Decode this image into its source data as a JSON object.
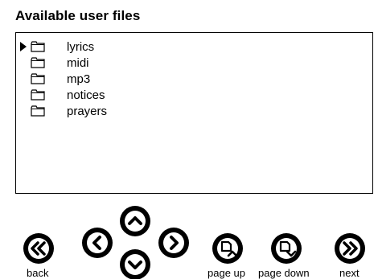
{
  "panel": {
    "title": "Available user files"
  },
  "files": [
    {
      "name": "lyrics",
      "icon": "folder-icon",
      "selected": true
    },
    {
      "name": "midi",
      "icon": "folder-icon",
      "selected": false
    },
    {
      "name": "mp3",
      "icon": "folder-icon",
      "selected": false
    },
    {
      "name": "notices",
      "icon": "folder-icon",
      "selected": false
    },
    {
      "name": "prayers",
      "icon": "folder-icon",
      "selected": false
    }
  ],
  "controls": {
    "back_label": "back",
    "page_up_label": "page up",
    "page_down_label": "page down",
    "next_label": "next"
  },
  "icons": {
    "back": "double-chevron-left-icon",
    "left": "chevron-left-icon",
    "up": "chevron-up-icon",
    "down": "chevron-down-icon",
    "right": "chevron-right-icon",
    "page_up": "page-up-icon",
    "page_down": "page-down-icon",
    "next": "double-chevron-right-icon"
  }
}
